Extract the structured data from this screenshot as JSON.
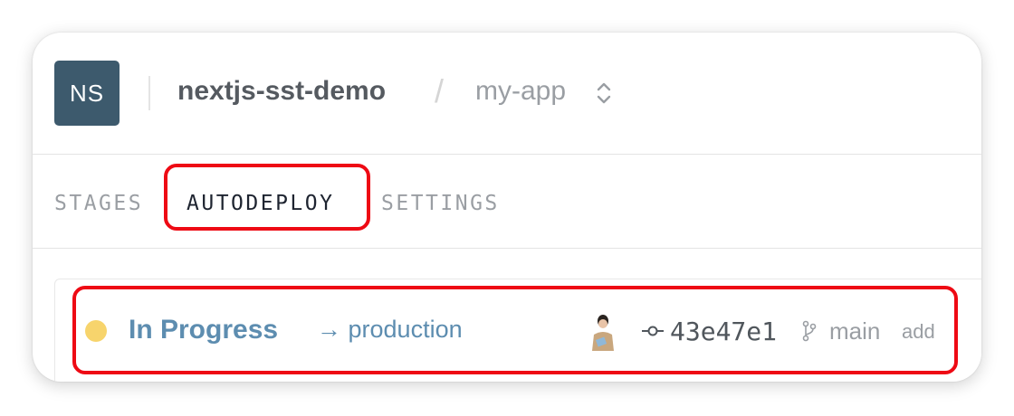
{
  "header": {
    "org_badge": "NS",
    "org_name": "nextjs-sst-demo",
    "separator": "/",
    "app_name": "my-app"
  },
  "tabs": [
    {
      "label": "STAGES",
      "active": false
    },
    {
      "label": "AUTODEPLOY",
      "active": true
    },
    {
      "label": "SETTINGS",
      "active": false
    }
  ],
  "deploy": {
    "status": "In Progress",
    "status_color": "#f7d46c",
    "target_arrow": "→",
    "target": "production",
    "commit_hash": "43e47e1",
    "branch": "main",
    "commit_message": "add"
  },
  "colors": {
    "accent": "#5d8db0",
    "badge_bg": "#3d5a6d",
    "highlight": "#ee0a14"
  }
}
